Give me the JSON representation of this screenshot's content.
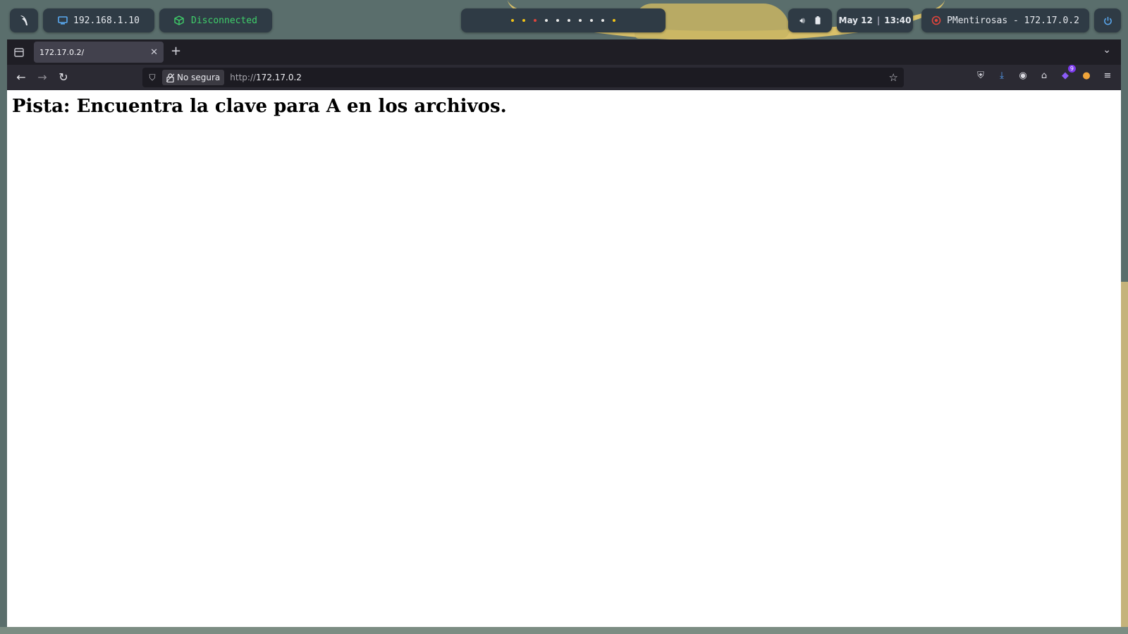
{
  "topbar": {
    "ip": "192.168.1.10",
    "vpn_status": "Disconnected",
    "workspace_dot_colors": [
      "#f2c417",
      "#f2c417",
      "#e0453c",
      "#e8e8e8",
      "#e8e8e8",
      "#e8e8e8",
      "#e8e8e8",
      "#e8e8e8",
      "#e8e8e8",
      "#f2c417"
    ],
    "date": "May 12",
    "time": "13:40",
    "target": "PMentirosas - 172.17.0.2",
    "icons": [
      "arch-logo-icon",
      "monitor-icon",
      "vpn-cube-icon",
      "volume-icon",
      "battery-icon",
      "target-icon",
      "power-icon"
    ]
  },
  "browser": {
    "tab_title": "172.17.0.2/",
    "security_label": "No segura",
    "url_scheme": "http://",
    "url_host": "172.17.0.2",
    "extension_badge": "9"
  },
  "page": {
    "heading": "Pista: Encuentra la clave para A en los archivos."
  },
  "colors": {
    "topbar_bg": "#2f3b45",
    "vpn_green": "#3fcf6a",
    "power_blue": "#5aa9f0",
    "tabbar_bg": "#1f1e25",
    "navbar_bg": "#2b2a33"
  }
}
